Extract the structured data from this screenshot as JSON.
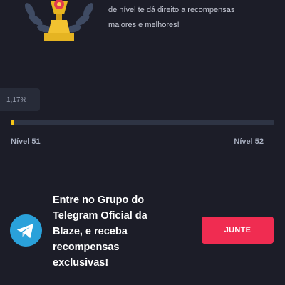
{
  "level_info": {
    "text_line_1": "de nível te dá direito a recompensas",
    "text_line_2": "maiores e melhores!"
  },
  "progress": {
    "percent_label": "1,17%",
    "percent_value": 1.17,
    "current_level": "Nível 51",
    "next_level": "Nível 52"
  },
  "telegram_promo": {
    "text": "Entre no Grupo do Telegram Oficial da Blaze, e receba recompensas exclusivas!",
    "button_label": "JUNTE"
  },
  "colors": {
    "background": "#1c1d28",
    "progress_fill": "#f5c518",
    "button": "#f02c51",
    "telegram": "#2aa1da"
  },
  "icons": [
    "trophy-icon",
    "telegram-icon"
  ]
}
